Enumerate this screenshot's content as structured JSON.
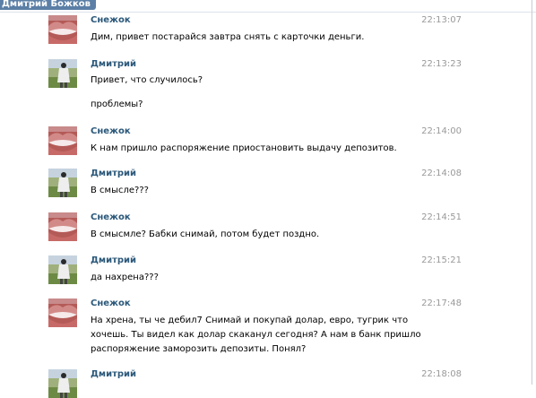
{
  "header": {
    "tab_label": "Дмитрий Божков"
  },
  "messages": [
    {
      "author": "Снежок",
      "time": "22:13:07",
      "lines": [
        "Дим, привет постарайся завтра снять с карточки деньги."
      ],
      "avatar": "lips-avatar-icon"
    },
    {
      "author": "Дмитрий",
      "time": "22:13:23",
      "lines": [
        "Привет, что случилось?",
        "проблемы?"
      ],
      "avatar": "person-avatar-icon"
    },
    {
      "author": "Снежок",
      "time": "22:14:00",
      "lines": [
        "К нам пришло распоряжение приостановить выдачу депозитов."
      ],
      "avatar": "lips-avatar-icon"
    },
    {
      "author": "Дмитрий",
      "time": "22:14:08",
      "lines": [
        "В смысле???"
      ],
      "avatar": "person-avatar-icon"
    },
    {
      "author": "Снежок",
      "time": "22:14:51",
      "lines": [
        "В смысмле? Бабки снимай, потом будет поздно."
      ],
      "avatar": "lips-avatar-icon"
    },
    {
      "author": "Дмитрий",
      "time": "22:15:21",
      "lines": [
        "да нахрена???"
      ],
      "avatar": "person-avatar-icon"
    },
    {
      "author": "Снежок",
      "time": "22:17:48",
      "lines": [
        "На хрена, ты че дебил7 Снимай и покупай долар, евро, тугрик что хочешь. Ты видел как долар скаканул сегодня? А нам в банк пришло распоряжение заморозить депозиты. Понял?"
      ],
      "avatar": "lips-avatar-icon"
    },
    {
      "author": "Дмитрий",
      "time": "22:18:08",
      "lines": [],
      "avatar": "person-avatar-icon"
    }
  ]
}
